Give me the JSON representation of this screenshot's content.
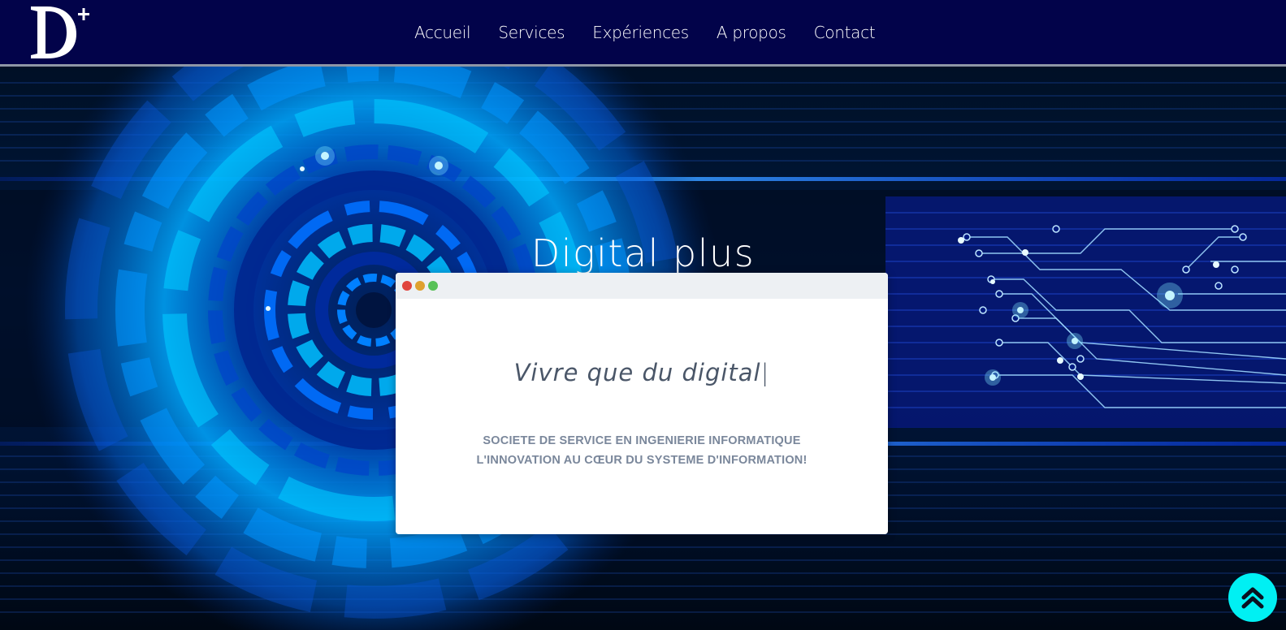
{
  "header": {
    "logo_text": "D+",
    "nav": [
      "Accueil",
      "Services",
      "Expériences",
      "A propos",
      "Contact"
    ]
  },
  "hero": {
    "title": "Digital plus",
    "typed_text": "Vivre que du digital",
    "caret": "|",
    "tagline_line1": "SOCIETE DE SERVICE EN INGENIERIE INFORMATIQUE",
    "tagline_line2": "L'INNOVATION AU CŒUR DU SYSTEME D'INFORMATION!"
  },
  "colors": {
    "navbar": "#02034a",
    "back_to_top": "#00f0f3",
    "hero_glow": "#00d2ff"
  },
  "icons": {
    "window_controls": [
      "close-dot",
      "minimize-dot",
      "maximize-dot"
    ],
    "back_to_top": "double-chevron-up-icon"
  }
}
